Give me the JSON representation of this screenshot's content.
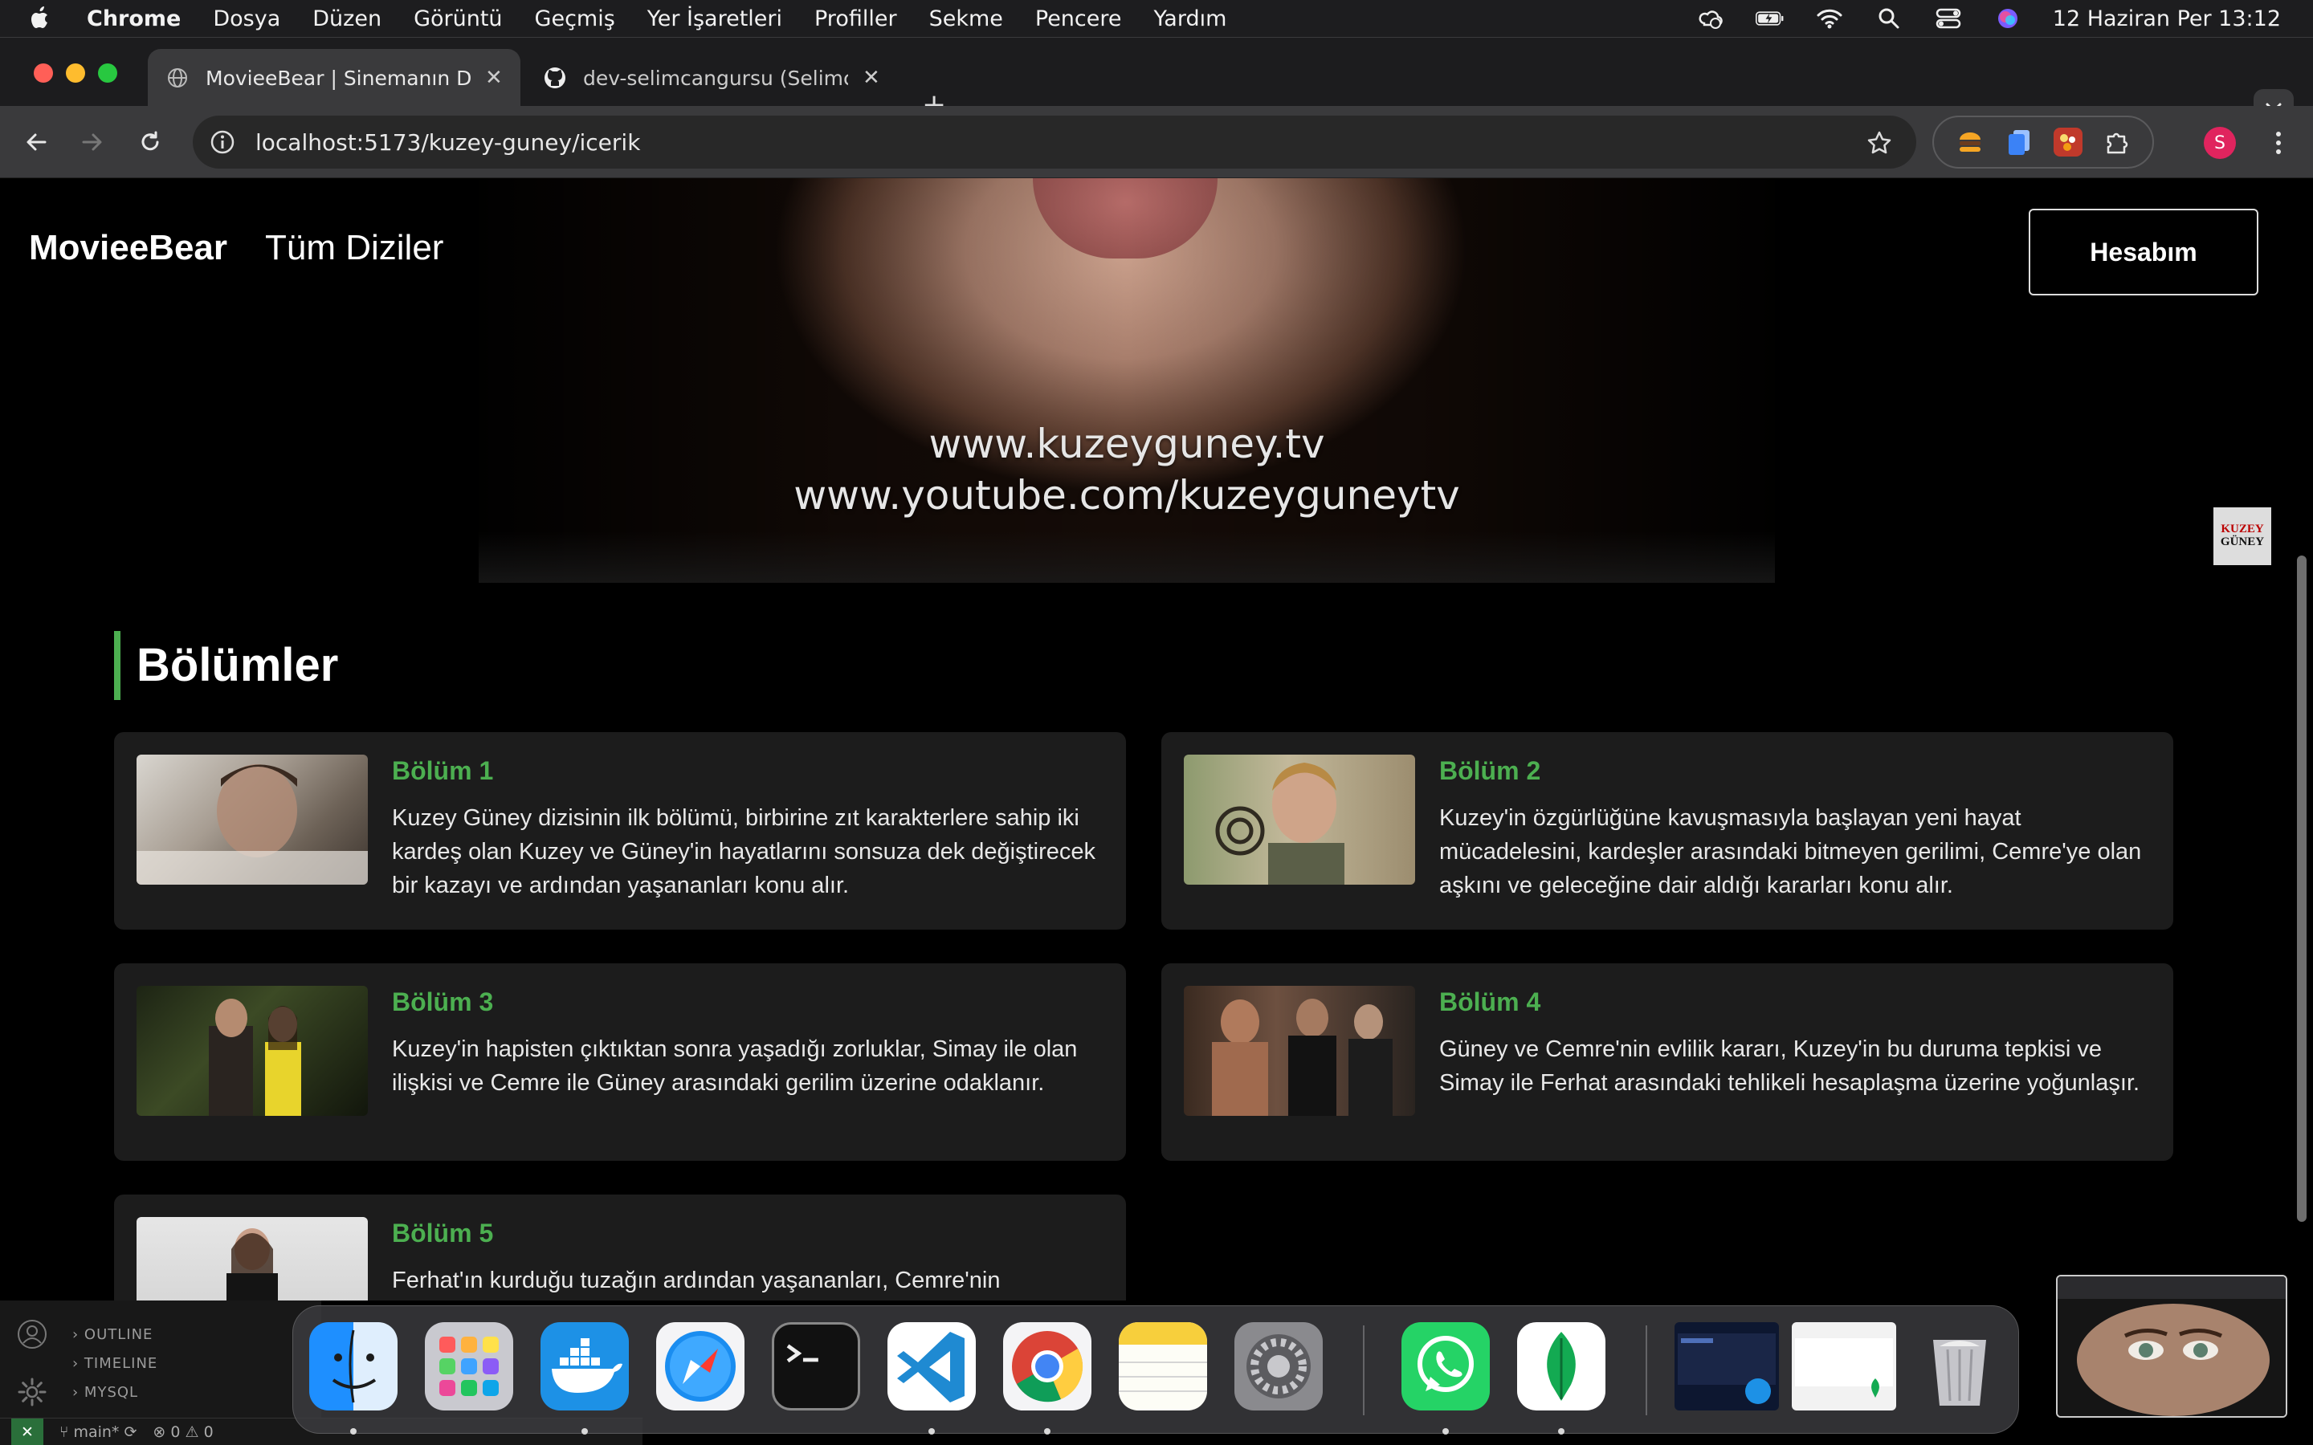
{
  "menubar": {
    "app_name": "Chrome",
    "items": [
      "Dosya",
      "Düzen",
      "Görüntü",
      "Geçmiş",
      "Yer İşaretleri",
      "Profiller",
      "Sekme",
      "Pencere",
      "Yardım"
    ],
    "clock": "12 Haziran Per  13:12"
  },
  "browser": {
    "tabs": [
      {
        "title": "MovieeBear | Sinemanın Dijital",
        "active": true
      },
      {
        "title": "dev-selimcangursu (Selimcan",
        "active": false
      }
    ],
    "url": "localhost:5173/kuzey-guney/icerik",
    "profile_initial": "S"
  },
  "site": {
    "logo": "MovieeBear",
    "nav_series": "Tüm Diziler",
    "account_button": "Hesabım",
    "hero_watermark_1": "www.kuzeyguney.tv",
    "hero_watermark_2": "www.youtube.com/kuzeyguneytv",
    "side_logo_line1": "KUZEY",
    "side_logo_line2": "GÜNEY",
    "section_title": "Bölümler",
    "episodes": [
      {
        "title": "Bölüm 1",
        "description": "Kuzey Güney dizisinin ilk bölümü, birbirine zıt karakterlere sahip iki kardeş olan Kuzey ve Güney'in hayatlarını sonsuza dek değiştirecek bir kazayı ve ardından yaşananları konu alır."
      },
      {
        "title": "Bölüm 2",
        "description": "Kuzey'in özgürlüğüne kavuşmasıyla başlayan yeni hayat mücadelesini, kardeşler arasındaki bitmeyen gerilimi, Cemre'ye olan aşkını ve geleceğine dair aldığı kararları konu alır."
      },
      {
        "title": "Bölüm 3",
        "description": "Kuzey'in hapisten çıktıktan sonra yaşadığı zorluklar, Simay ile olan ilişkisi ve Cemre ile Güney arasındaki gerilim üzerine odaklanır."
      },
      {
        "title": "Bölüm 4",
        "description": "Güney ve Cemre'nin evlilik kararı, Kuzey'in bu duruma tepkisi ve Simay ile Ferhat arasındaki tehlikeli hesaplaşma üzerine yoğunlaşır."
      },
      {
        "title": "Bölüm 5",
        "description": "Ferhat'ın kurduğu tuzağın ardından yaşananları, Cemre'nin"
      }
    ]
  },
  "vscode": {
    "panels": [
      "OUTLINE",
      "TIMELINE",
      "MYSQL"
    ],
    "branch": "main*",
    "errors": "0",
    "warnings": "0"
  },
  "dock": {
    "apps": [
      "finder-icon",
      "launchpad-icon",
      "docker-icon",
      "safari-icon",
      "terminal-icon",
      "vscode-icon",
      "chrome-icon",
      "notes-icon",
      "system-settings-icon",
      "whatsapp-icon",
      "mongodb-compass-icon",
      "trash-icon"
    ]
  },
  "colors": {
    "accent_green": "#4caf50",
    "card_bg": "#1c1c1c",
    "page_bg": "#000000"
  }
}
